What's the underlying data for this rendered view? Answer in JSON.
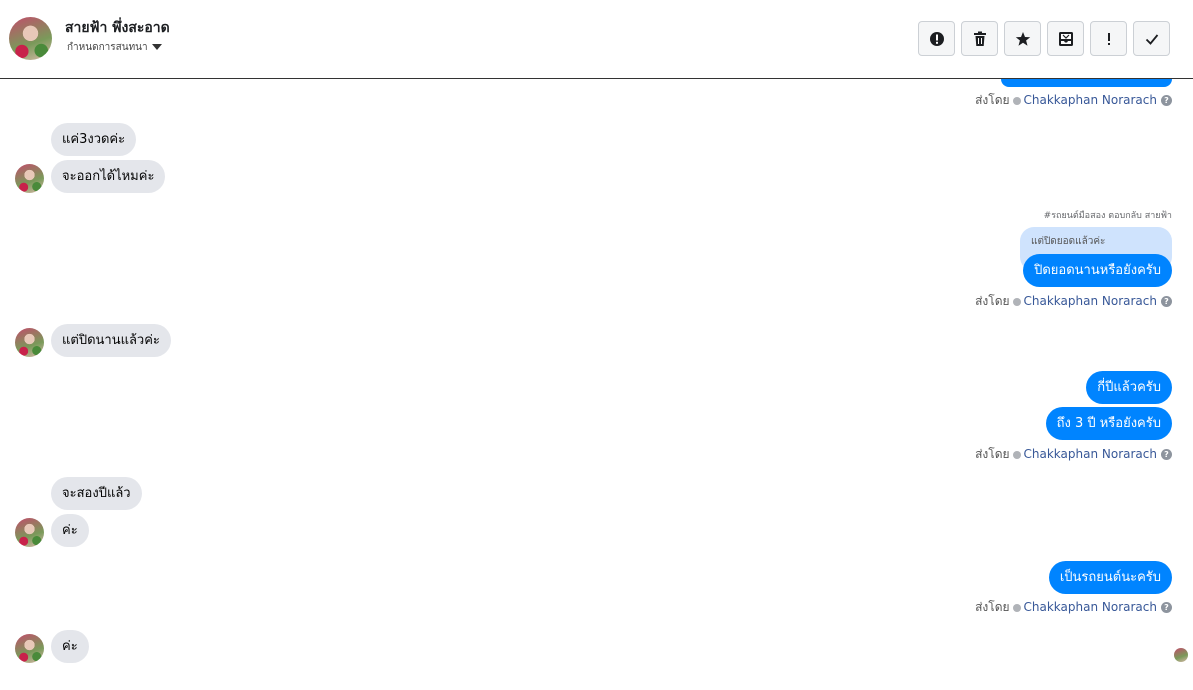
{
  "header": {
    "contact_name": "สายฟ้า พึ่งสะอาด",
    "subtitle": "กำหนดการสนทนา",
    "toolbar": [
      {
        "icon": "alert-circle-icon",
        "label": "report"
      },
      {
        "icon": "trash-icon",
        "label": "delete"
      },
      {
        "icon": "star-icon",
        "label": "star"
      },
      {
        "icon": "inbox-icon",
        "label": "move to inbox"
      },
      {
        "icon": "exclamation-icon",
        "label": "mark spam"
      },
      {
        "icon": "check-icon",
        "label": "done"
      }
    ]
  },
  "messages": {
    "in_1": "แค่3งวดค่ะ",
    "in_2": "จะออกได้ไหมค่ะ",
    "reply_header": "#รถยนต์มือสอง ตอบกลับ สายฟ้า",
    "reply_quote": "แต่ปิดยอดแล้วค่ะ",
    "out_1": "ปิดยอดนานหรือยังครับ",
    "in_3": "แต่ปิดนานแล้วค่ะ",
    "out_2": "กี่ปีแล้วครับ",
    "out_3": "ถึง 3 ปี หรือยังครับ",
    "in_4": "จะสองปีแล้ว",
    "in_5": "ค่ะ",
    "out_4": "เป็นรถยนต์นะครับ",
    "in_6": "ค่ะ"
  },
  "sent_by": {
    "prefix": "ส่งโดย",
    "name": "Chakkaphan Norarach",
    "help": "?"
  },
  "colors": {
    "outgoing": "#0084ff",
    "incoming": "#e4e6eb",
    "reply_quote": "#cfe3fd",
    "link": "#385898"
  }
}
